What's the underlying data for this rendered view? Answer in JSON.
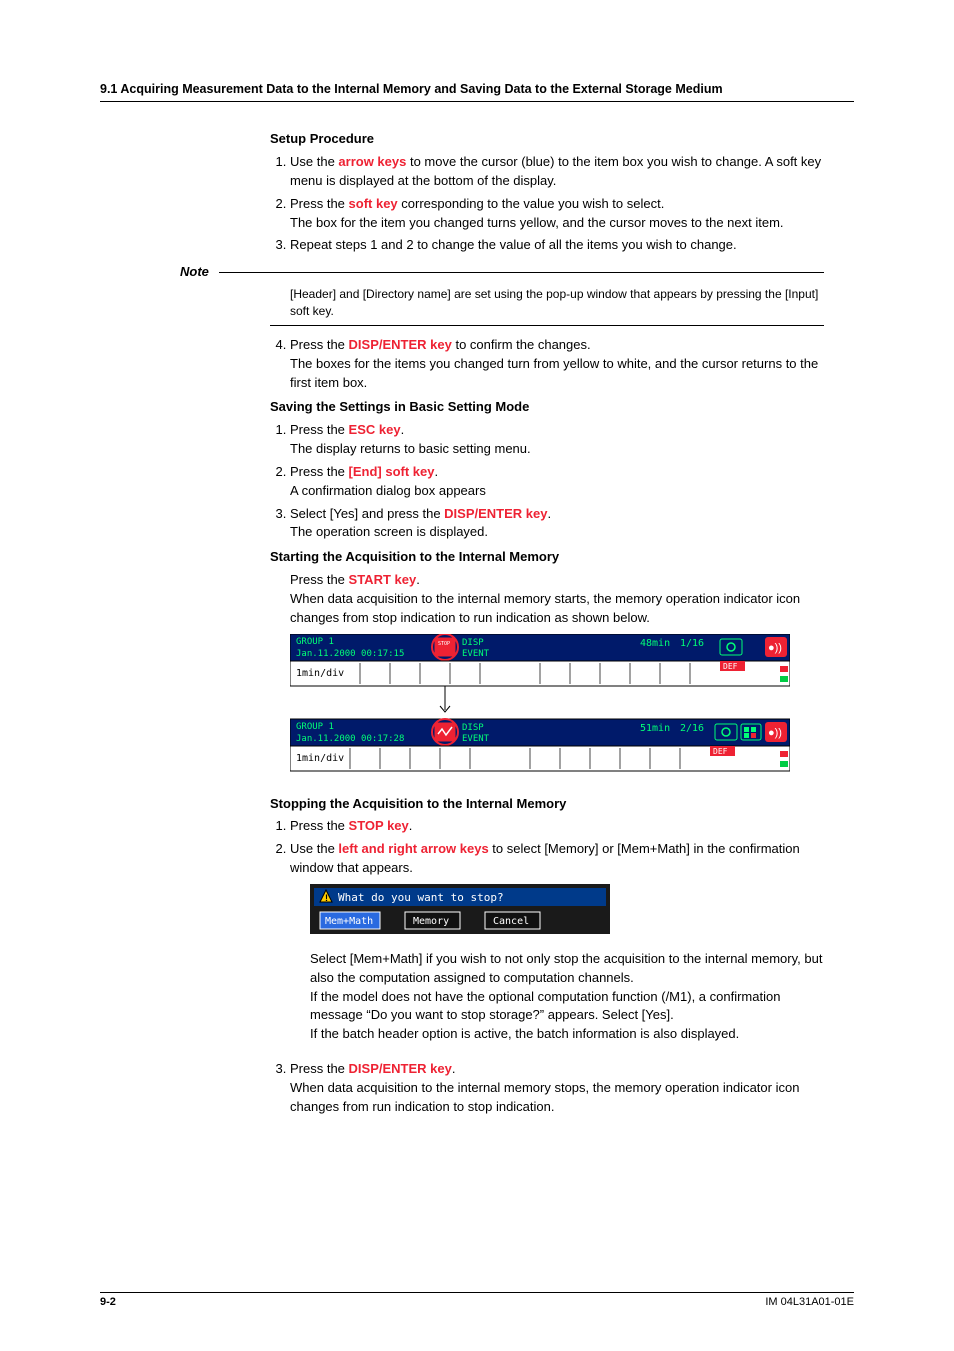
{
  "header": {
    "section_title": "9.1  Acquiring Measurement Data to the Internal Memory and Saving Data to the External Storage Medium"
  },
  "setup": {
    "title": "Setup Procedure",
    "step1_lead": "Use the ",
    "step1_key": "arrow keys",
    "step1_tail": " to move the cursor (blue) to the item box you wish to change. A soft key menu is displayed at the bottom of the display.",
    "step2_lead": "Press the ",
    "step2_key": "soft key",
    "step2_tail": " corresponding to the value you wish to select.",
    "step2_extra": "The box for the item you changed turns yellow, and the cursor moves to the next item.",
    "step3": "Repeat steps 1 and 2 to change the value of all the items you wish to change."
  },
  "note": {
    "label": "Note",
    "text": "[Header] and [Directory name] are set using the pop-up window that appears by pressing the [Input] soft key."
  },
  "setup4": {
    "lead": "Press the ",
    "key": "DISP/ENTER key",
    "tail": " to confirm the changes.",
    "extra": "The boxes for the items you changed turn from yellow to white, and the cursor returns to the first item box."
  },
  "saving": {
    "title": "Saving the Settings in Basic Setting Mode",
    "step1_lead": "Press the ",
    "step1_key": "ESC key",
    "step1_tail": ".",
    "step1_extra": "The display returns to basic setting menu.",
    "step2_lead": "Press the ",
    "step2_key": "[End] soft key",
    "step2_tail": ".",
    "step2_extra": "A confirmation dialog box appears",
    "step3_lead": "Select [Yes] and press the ",
    "step3_key": "DISP/ENTER key",
    "step3_tail": ".",
    "step3_extra": "The operation screen is displayed."
  },
  "starting": {
    "title": "Starting the Acquisition to the Internal Memory",
    "line1_lead": "Press the ",
    "line1_key": "START key",
    "line1_tail": ".",
    "line2": "When data acquisition to the internal memory starts, the memory operation indicator icon changes from stop indication to run indication as shown below."
  },
  "screen1": {
    "group": "GROUP 1",
    "date": "Jan.11.2000 00:17:15",
    "disp": "DISP",
    "event": "EVENT",
    "time": "48min",
    "page": "1/16",
    "def": "DEF",
    "yaxis": "1min/div"
  },
  "screen2": {
    "group": "GROUP 1",
    "date": "Jan.11.2000 00:17:28",
    "disp": "DISP",
    "event": "EVENT",
    "time": "51min",
    "page": "2/16",
    "def": "DEF",
    "yaxis": "1min/div"
  },
  "stopping": {
    "title": "Stopping the Acquisition to the Internal Memory",
    "step1_lead": "Press the ",
    "step1_key": "STOP key",
    "step1_tail": ".",
    "step2_lead": "Use the ",
    "step2_key": "left and right arrow keys",
    "step2_tail": " to select [Memory] or [Mem+Math] in the confirmation window that appears."
  },
  "dialog": {
    "title": "What do you want to stop?",
    "btn1": "Mem+Math",
    "btn2": "Memory",
    "btn3": "Cancel"
  },
  "stopping_after": {
    "p1": "Select [Mem+Math] if you wish to not only stop the acquisition to the internal memory, but also the computation assigned to computation channels.",
    "p2": "If the model does not have the optional computation function (/M1), a confirmation message “Do you want to stop storage?” appears.  Select [Yes].",
    "p3": "If the batch header option is active, the batch information is also displayed.",
    "step3_lead": "Press the ",
    "step3_key": "DISP/ENTER key",
    "step3_tail": ".",
    "step3_extra": "When data acquisition to the internal memory stops, the memory operation indicator icon changes from run indication to stop indication."
  },
  "footer": {
    "page": "9-2",
    "doc": "IM 04L31A01-01E"
  }
}
